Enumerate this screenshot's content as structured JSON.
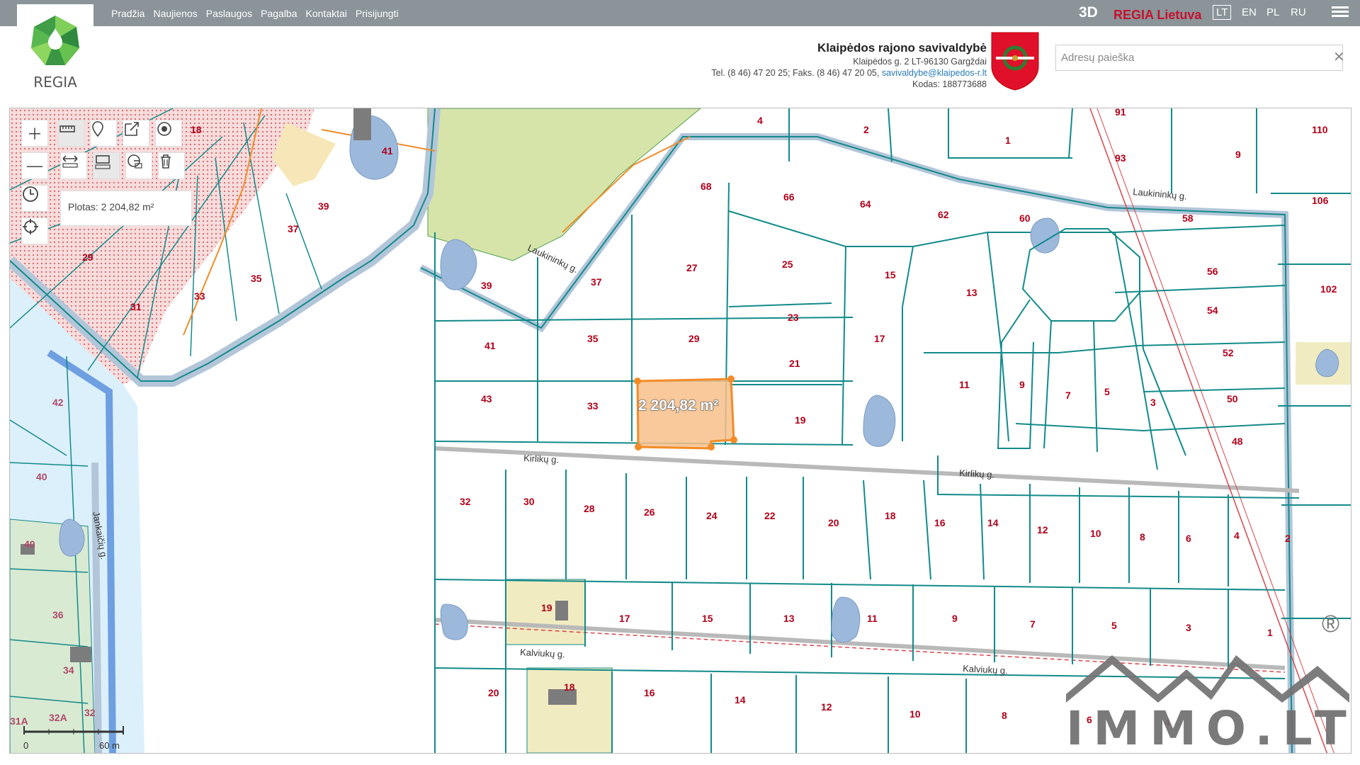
{
  "header": {
    "logo_text": "REGIA",
    "nav": [
      "Pradžia",
      "Naujienos",
      "Paslaugos",
      "Pagalba",
      "Kontaktai",
      "Prisijungti"
    ],
    "btn_3d": "3D",
    "brand": "REGIA Lietuva",
    "languages": [
      "LT",
      "EN",
      "PL",
      "RU"
    ],
    "active_language": "LT",
    "menu_icon": "hamburger-icon"
  },
  "org": {
    "name": "Klaipėdos rajono savivaldybė",
    "address": "Klaipėdos g. 2 LT-96130 Gargždai",
    "phones": "Tel. (8 46) 47 20 25; Faks. (8 46) 47 20 05,",
    "email": "savivaldybe@klaipedos-r.lt",
    "code": "Kodas: 188773688"
  },
  "search": {
    "placeholder": "Adresų paieška",
    "value": "",
    "clear_icon": "close-icon"
  },
  "tools": {
    "zoom_in_icon": "plus-icon",
    "zoom_out_icon": "minus-icon",
    "history_icon": "clock-icon",
    "locate_icon": "crosshair-icon",
    "measure_icon": "ruler-icon",
    "marker_icon": "pin-icon",
    "share_icon": "share-icon",
    "layers_icon": "target-icon",
    "measure_distance_icon": "distance-icon",
    "measure_area_icon": "area-icon",
    "measure_radius_icon": "radius-icon",
    "delete_icon": "trash-icon"
  },
  "measure": {
    "result": "Plotas: 2 204,82 m²",
    "area_label": "2 204,82 m²"
  },
  "scale": {
    "start": "0",
    "end": "60 m"
  },
  "streets": [
    "Laukininkų g.",
    "Laukininkų g.",
    "Kirlikų g.",
    "Kirlikų g.",
    "Kalviukų g.",
    "Kalviukų g.",
    "Jankaičių g."
  ],
  "watermark": {
    "text": "IMMO.LT",
    "reg": "®"
  },
  "colors": {
    "parcel_line": "#138a8a",
    "parcel_label": "#b0001a",
    "road": "#b3c6d9",
    "selection": "#f28c28",
    "water": "#9cb9dc",
    "forest": "#d6e4a9"
  }
}
